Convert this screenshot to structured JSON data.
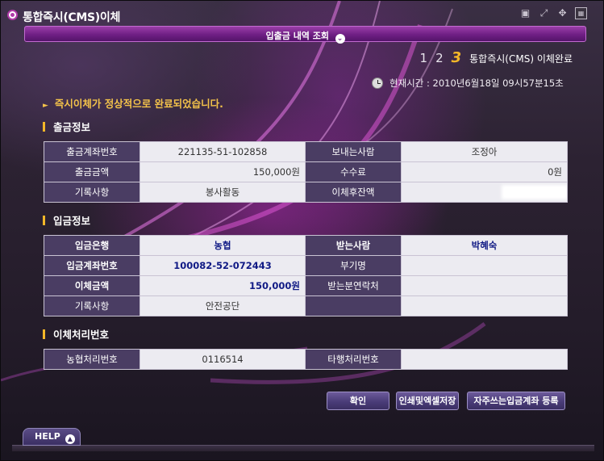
{
  "window": {
    "title": "통합즉시(CMS)이체"
  },
  "subbar": {
    "title": "입출금 내역 조회"
  },
  "steps": {
    "items": [
      "1",
      "2",
      "3"
    ],
    "active_label": "통합즉시(CMS) 이체완료"
  },
  "clock": {
    "label": "현재시간 : 2010년6월18일 09시57분15초"
  },
  "message": "즉시이체가 정상적으로 완료되었습니다.",
  "withdraw": {
    "heading": "출금정보",
    "rows": [
      {
        "l1": "출금계좌번호",
        "v1": "221135-51-102858",
        "l2": "보내는사람",
        "v2": "조정아"
      },
      {
        "l1": "출금금액",
        "v1": "150,000원",
        "l2": "수수료",
        "v2": "0원"
      },
      {
        "l1": "기록사항",
        "v1": "봉사활동",
        "l2": "이체후잔액",
        "v2": ""
      }
    ]
  },
  "deposit": {
    "heading": "입금정보",
    "rows": [
      {
        "l1": "입금은행",
        "v1": "농협",
        "l2": "받는사람",
        "v2": "박혜숙"
      },
      {
        "l1": "입금계좌번호",
        "v1": "100082-52-072443",
        "l2": "부기명",
        "v2": ""
      },
      {
        "l1": "이체금액",
        "v1": "150,000원",
        "l2": "받는분연락처",
        "v2": ""
      },
      {
        "l1": "기록사항",
        "v1": "안전공단",
        "l2": "",
        "v2": ""
      }
    ]
  },
  "process": {
    "heading": "이체처리번호",
    "rows": [
      {
        "l1": "농협처리번호",
        "v1": "0116514",
        "l2": "타행처리번호",
        "v2": ""
      }
    ]
  },
  "buttons": {
    "ok": "확인",
    "print": "인쇄및엑셀저장",
    "favorite": "자주쓰는입금계좌 등록"
  },
  "help": {
    "label": "HELP"
  },
  "icons": {
    "title": "radio-bullet-icon",
    "win": [
      "mouse-icon",
      "resize-icon",
      "move-icon",
      "close-box-icon"
    ]
  }
}
